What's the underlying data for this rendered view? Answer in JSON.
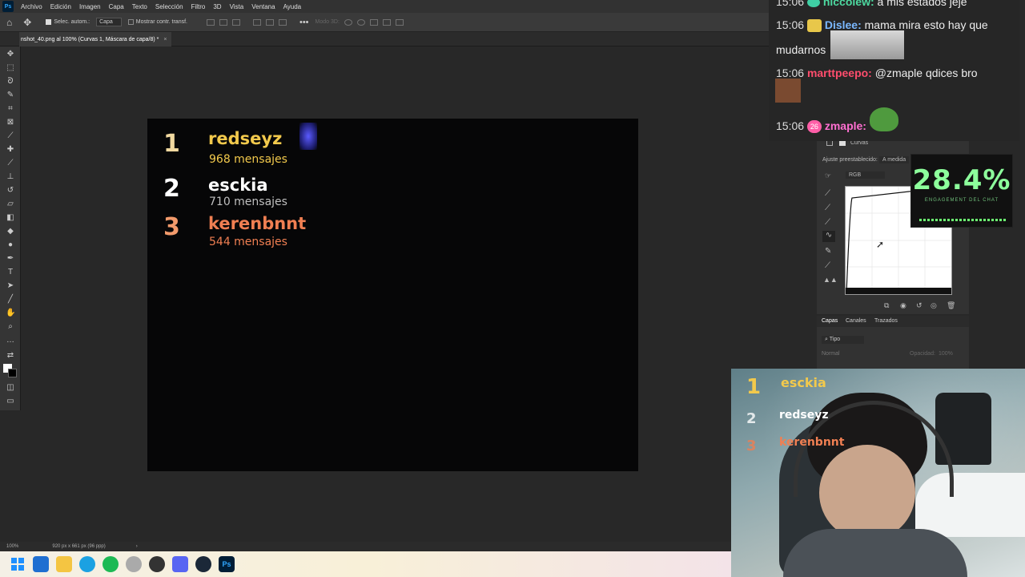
{
  "menubar": {
    "app_icon": "Ps",
    "items": [
      "Archivo",
      "Edición",
      "Imagen",
      "Capa",
      "Texto",
      "Selección",
      "Filtro",
      "3D",
      "Vista",
      "Ventana",
      "Ayuda"
    ]
  },
  "options_bar": {
    "auto_select_label": "Selec. autom.:",
    "auto_select_value": "Capa",
    "show_transform_label": "Mostrar contr. transf.",
    "mode_3d_label": "Modo 3D:"
  },
  "document_tab": {
    "title": "nshot_40.png al 100% (Curvas 1, Máscara de capa/8) *",
    "close": "×"
  },
  "canvas": {
    "ranking": [
      {
        "rank": "1",
        "name": "redseyz",
        "messages": "968 mensajes",
        "color": "#f2c94c",
        "num_color": "#f1d9a0"
      },
      {
        "rank": "2",
        "name": "esckia",
        "messages": "710 mensajes",
        "color": "#ffffff",
        "num_color": "#ffffff"
      },
      {
        "rank": "3",
        "name": "kerenbnnt",
        "messages": "544 mensajes",
        "color": "#f07f52",
        "num_color": "#f29a6b"
      }
    ]
  },
  "status_bar": {
    "zoom": "100%",
    "doc_size": "920 px x 661 px (96 ppp)"
  },
  "chat": {
    "messages": [
      {
        "time": "15:06",
        "user": "niccolew:",
        "text": "a mis estados jeje",
        "user_color": "#4dd9a0"
      },
      {
        "time": "15:06",
        "user": "Dislee:",
        "text": "mama mira esto hay que",
        "text2": "mudarnos",
        "user_color": "#7ab8ff"
      },
      {
        "time": "15:06",
        "user": "marttpeepo:",
        "text": "@zmaple qdices bro",
        "mention": "@zmaple",
        "user_color": "#ff4d6d"
      },
      {
        "time": "15:06",
        "user": "zmaple:",
        "badge": "26",
        "user_color": "#ff6fd1"
      }
    ]
  },
  "curves_panel": {
    "title": "Curvas",
    "preset_label": "Ajuste preestablecido:",
    "preset_value": "A medida",
    "channel": "RGB"
  },
  "engagement": {
    "value": "28.4%",
    "label": "ENGAGEMENT DEL CHAT"
  },
  "layers_panel": {
    "tabs": [
      "Capas",
      "Canales",
      "Trazados"
    ],
    "filter": "Tipo",
    "blend": "Normal",
    "opacity_label": "Opacidad:",
    "opacity_value": "100%"
  },
  "webcam_overlay": {
    "ranking": [
      {
        "rank": "1",
        "name": "esckia",
        "color": "#f2c94c"
      },
      {
        "rank": "2",
        "name": "redseyz",
        "color": "#ffffff"
      },
      {
        "rank": "3",
        "name": "kerenbnnt",
        "color": "#f07f52"
      }
    ]
  }
}
